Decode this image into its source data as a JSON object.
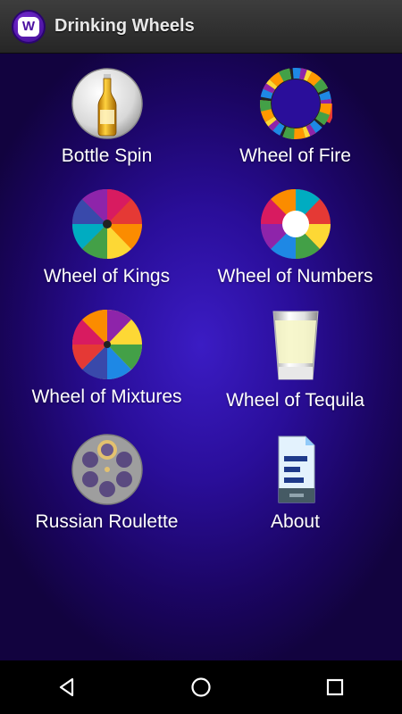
{
  "app": {
    "title": "Drinking Wheels",
    "icon": "app-logo-icon",
    "accent": "#2a0e9a"
  },
  "menu": {
    "items": [
      {
        "label": "Bottle Spin",
        "icon": "beer-bottle-icon"
      },
      {
        "label": "Wheel of Fire",
        "icon": "fire-wheel-icon"
      },
      {
        "label": "Wheel of Kings",
        "icon": "kings-wheel-icon"
      },
      {
        "label": "Wheel of Numbers",
        "icon": "numbers-wheel-icon"
      },
      {
        "label": "Wheel of Mixtures",
        "icon": "mixtures-wheel-icon"
      },
      {
        "label": "Wheel of Tequila",
        "icon": "shot-glass-icon"
      },
      {
        "label": "Russian Roulette",
        "icon": "revolver-cylinder-icon"
      },
      {
        "label": "About",
        "icon": "document-icon"
      }
    ]
  },
  "navigation": {
    "back": "back-icon",
    "home": "home-icon",
    "recents": "recents-icon"
  }
}
